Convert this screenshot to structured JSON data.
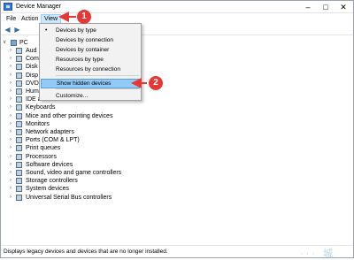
{
  "window": {
    "title": "Device Manager"
  },
  "menubar": {
    "items": [
      "File",
      "Action",
      "View"
    ]
  },
  "tree": {
    "root": "PC",
    "items": [
      "Aud",
      "Com",
      "Disk",
      "Disp",
      "DVD",
      "Hum",
      "IDE a",
      "Keyboards",
      "Mice and other pointing devices",
      "Monitors",
      "Network adapters",
      "Ports (COM & LPT)",
      "Print queues",
      "Processors",
      "Software devices",
      "Sound, video and game controllers",
      "Storage controllers",
      "System devices",
      "Universal Serial Bus controllers"
    ]
  },
  "view_menu": {
    "items": [
      {
        "label": "Devices by type",
        "checked": true
      },
      {
        "label": "Devices by connection"
      },
      {
        "label": "Devices by container"
      },
      {
        "label": "Resources by type"
      },
      {
        "label": "Resources by connection"
      },
      {
        "label": "Show hidden devices",
        "highlighted": true
      },
      {
        "label": "Customize..."
      }
    ]
  },
  "callouts": [
    "1",
    "2"
  ],
  "status": {
    "text": "Displays legacy devices and devices that are no longer installed."
  },
  "watermark": "··· 城",
  "colors": {
    "callout": "#e53935",
    "highlight": "#91c9f7",
    "menu_active": "#cce8ff"
  }
}
